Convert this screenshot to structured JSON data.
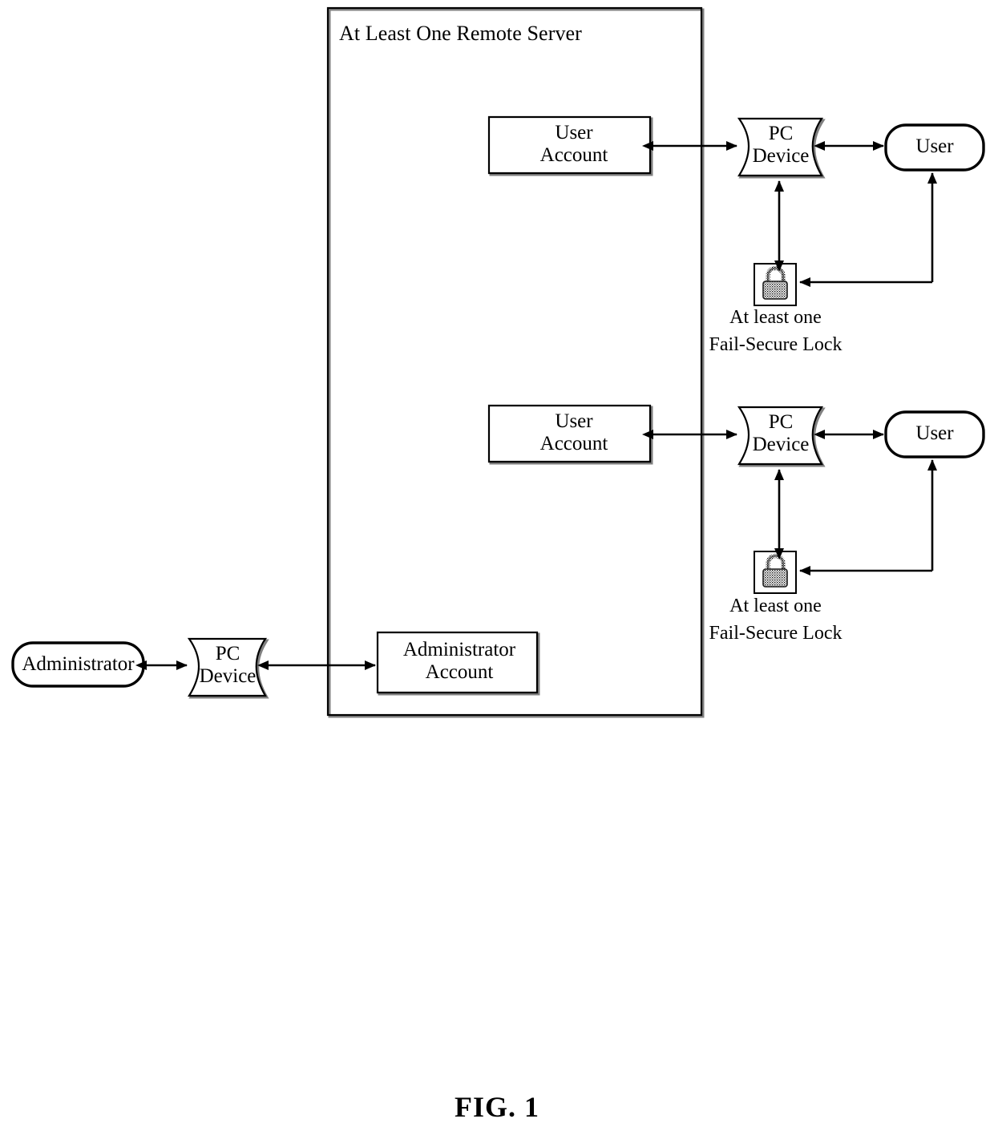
{
  "figure": {
    "caption": "FIG. 1"
  },
  "server": {
    "title": "At Least One Remote Server"
  },
  "rows": [
    {
      "account_label": "User\nAccount",
      "device_label": "PC\nDevice",
      "actor_label": "User",
      "lock_icon": "padlock-icon",
      "lock_caption_line1": "At least one",
      "lock_caption_line2": "Fail-Secure Lock"
    },
    {
      "account_label": "User\nAccount",
      "device_label": "PC\nDevice",
      "actor_label": "User",
      "lock_icon": "padlock-icon",
      "lock_caption_line1": "At least one",
      "lock_caption_line2": "Fail-Secure Lock"
    }
  ],
  "admin_row": {
    "actor_label": "Administrator",
    "device_label": "PC\nDevice",
    "account_label": "Administrator\nAccount"
  },
  "colors": {
    "stroke": "#000000",
    "background": "#ffffff",
    "shadow": "#808080"
  }
}
